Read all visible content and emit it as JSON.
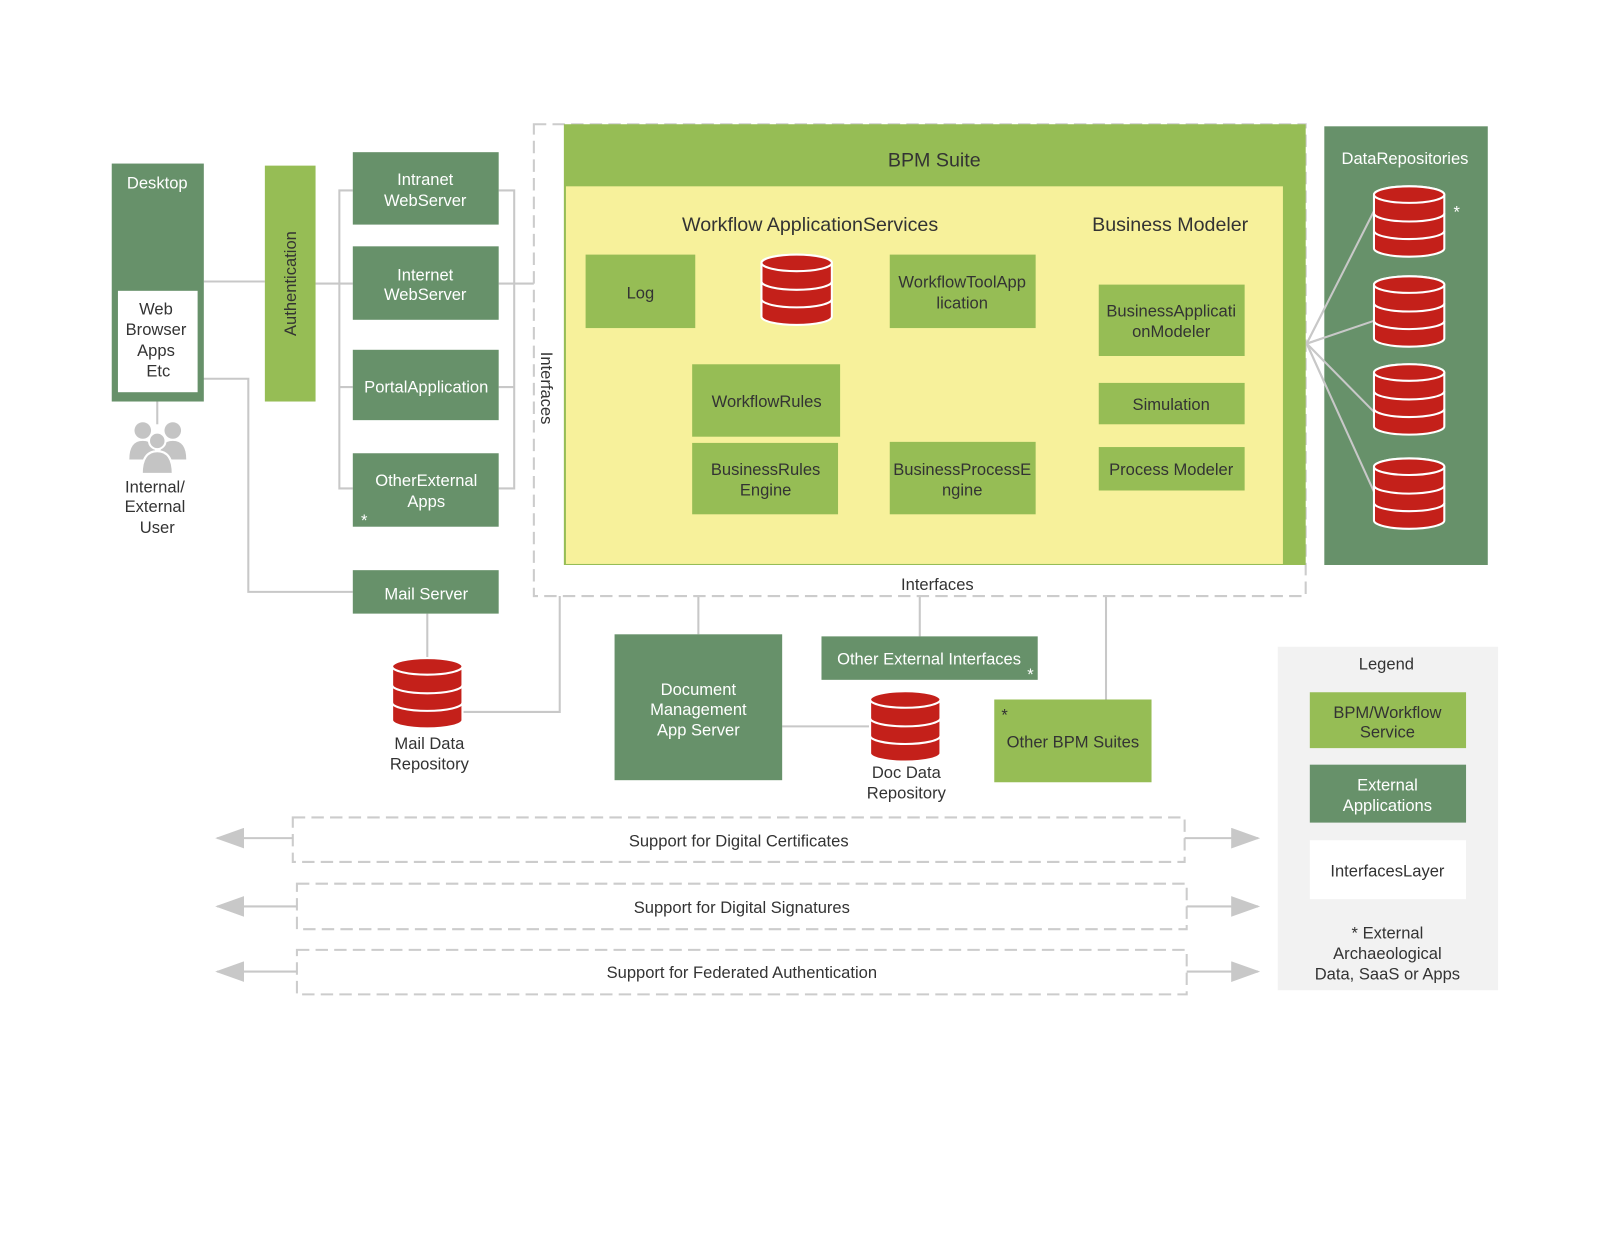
{
  "colors": {
    "external": "#67916a",
    "bpm": "#96bd55",
    "bpm_inner": "#f7f19b",
    "database": "#c4201a",
    "legend_bg": "#f2f2f2"
  },
  "desktop": {
    "title": "Desktop",
    "inner": [
      "Web",
      "Browser",
      "Apps",
      "Etc"
    ]
  },
  "user": {
    "icon": "users-icon",
    "label": [
      "Internal/",
      "External",
      "User"
    ]
  },
  "authentication": "Authentication",
  "servers": {
    "intranet": [
      "Intranet",
      "WebServer"
    ],
    "internet": [
      "Internet",
      "WebServer"
    ],
    "portal": "PortalApplication",
    "other_external": [
      "OtherExternal",
      "Apps"
    ],
    "mail": "Mail Server"
  },
  "mail_repo": [
    "Mail Data",
    "Repository"
  ],
  "interfaces": {
    "side": "Interfaces",
    "bottom": "Interfaces"
  },
  "bpm_suite": {
    "title": "BPM Suite",
    "workflow_title": "Workflow ApplicationServices",
    "modeler_title": "Business Modeler",
    "log": "Log",
    "workflow_tool": [
      "WorkflowToolApp",
      "lication"
    ],
    "workflow_rules": "WorkflowRules",
    "rules_engine": [
      "BusinessRules",
      "Engine"
    ],
    "process_engine": [
      "BusinessProcessE",
      "ngine"
    ],
    "app_modeler": [
      "BusinessApplicati",
      "onModeler"
    ],
    "simulation": "Simulation",
    "process_modeler": "Process Modeler"
  },
  "data_repositories": {
    "title": "DataRepositories",
    "asterisk": "*"
  },
  "doc_server": [
    "Document",
    "Management",
    "App Server"
  ],
  "other_ext_interfaces": "Other External Interfaces",
  "doc_repo": [
    "Doc Data",
    "Repository"
  ],
  "other_bpm": "Other BPM Suites",
  "asterisk": "*",
  "support": [
    "Support for Digital Certificates",
    "Support for Digital Signatures",
    "Support for Federated Authentication"
  ],
  "legend": {
    "title": "Legend",
    "bpm": [
      "BPM/Workflow",
      "Service"
    ],
    "external": [
      "External",
      "Applications"
    ],
    "interfaces": "InterfacesLayer",
    "note": [
      "*  External",
      "Archaeological",
      "Data, SaaS or Apps"
    ]
  }
}
